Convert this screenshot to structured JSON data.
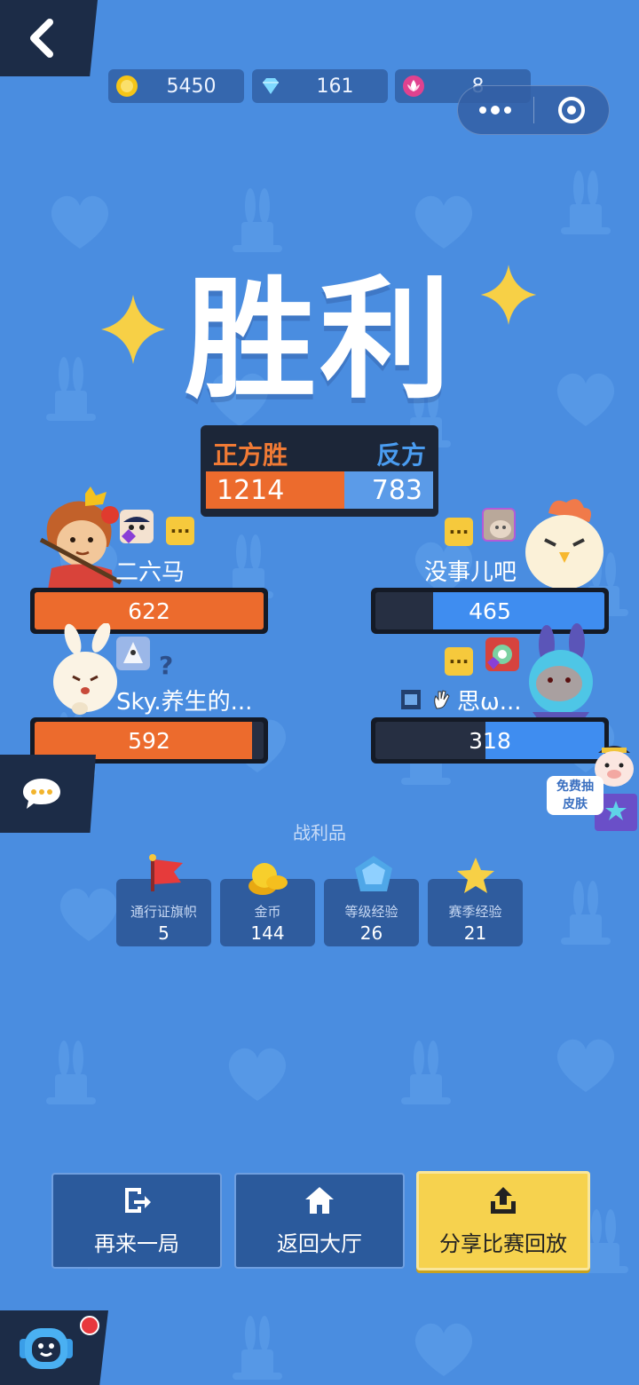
{
  "currency": [
    {
      "icon": "coin-icon",
      "value": "5450"
    },
    {
      "icon": "diamond-icon",
      "value": "161"
    },
    {
      "icon": "lotus-icon",
      "value": "8"
    }
  ],
  "title": "胜利",
  "score": {
    "pro_label": "正方胜",
    "con_label": "反方",
    "pro_value": "1214",
    "con_value": "783",
    "pro_share": 0.608
  },
  "players": {
    "left": [
      {
        "name": "二六马",
        "score": "622",
        "fill": 1.0
      },
      {
        "name": "Sky.养生的...",
        "score": "592",
        "fill": 0.95,
        "badge": "?"
      }
    ],
    "right": [
      {
        "name": "没事儿吧",
        "score": "465",
        "fill": 0.75
      },
      {
        "name": "思ω...",
        "score": "318",
        "fill": 0.52
      }
    ]
  },
  "chat_bubble_text": "···",
  "free_skin": {
    "line1": "免费抽",
    "line2": "皮肤"
  },
  "loot": {
    "title": "战利品",
    "items": [
      {
        "icon": "flag-icon",
        "name": "通行证旗帜",
        "value": "5"
      },
      {
        "icon": "coins-icon",
        "name": "金币",
        "value": "144"
      },
      {
        "icon": "crystal-icon",
        "name": "等级经验",
        "value": "26"
      },
      {
        "icon": "star-icon",
        "name": "赛季经验",
        "value": "21"
      }
    ]
  },
  "actions": {
    "replay": "再来一局",
    "lobby": "返回大厅",
    "share": "分享比赛回放"
  },
  "colors": {
    "background": "#4a8de0",
    "pro": "#ec6b2d",
    "con": "#3f8df0",
    "primary_button": "#f6d24e"
  }
}
